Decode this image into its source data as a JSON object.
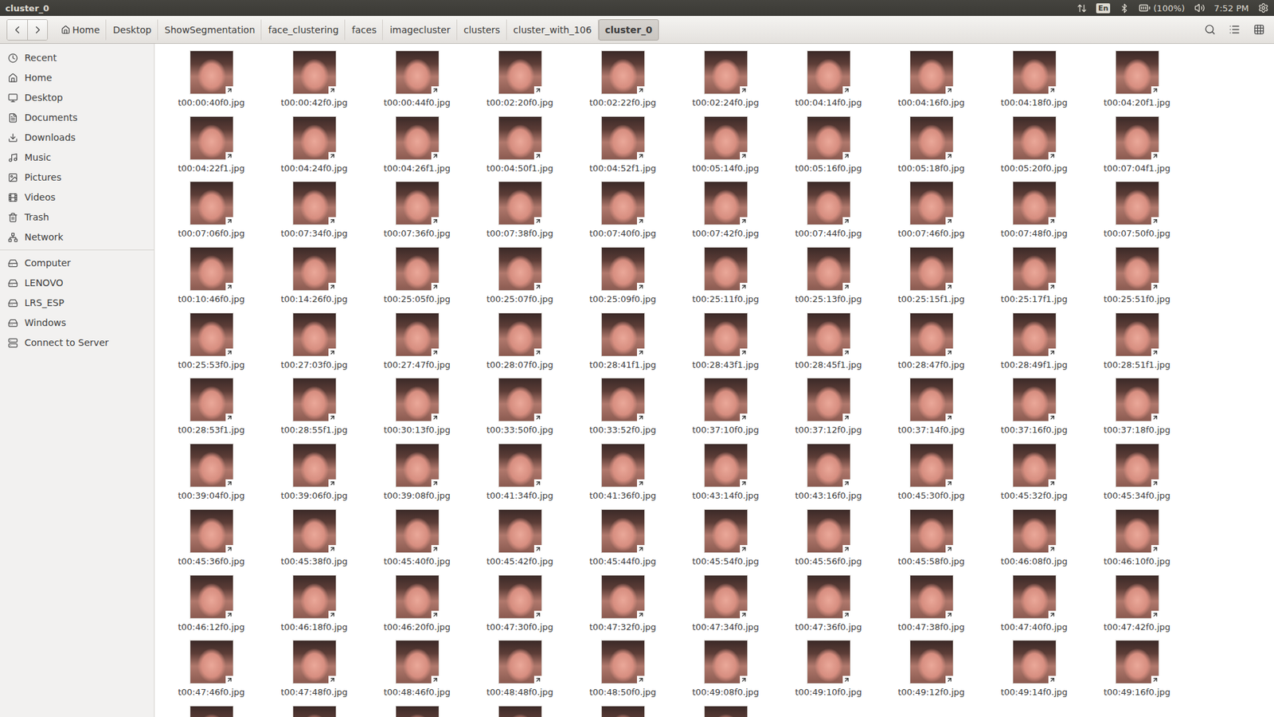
{
  "window": {
    "title": "cluster_0"
  },
  "panel": {
    "language": "En",
    "battery": "(100%)",
    "clock": "7:52 PM"
  },
  "pathbar": [
    {
      "label": "Home",
      "selected": false
    },
    {
      "label": "Desktop",
      "selected": false
    },
    {
      "label": "ShowSegmentation",
      "selected": false
    },
    {
      "label": "face_clustering",
      "selected": false
    },
    {
      "label": "faces",
      "selected": false
    },
    {
      "label": "imagecluster",
      "selected": false
    },
    {
      "label": "clusters",
      "selected": false
    },
    {
      "label": "cluster_with_106",
      "selected": false
    },
    {
      "label": "cluster_0",
      "selected": true
    }
  ],
  "sidebar": {
    "places": [
      {
        "label": "Recent"
      },
      {
        "label": "Home"
      },
      {
        "label": "Desktop"
      },
      {
        "label": "Documents"
      },
      {
        "label": "Downloads"
      },
      {
        "label": "Music"
      },
      {
        "label": "Pictures"
      },
      {
        "label": "Videos"
      },
      {
        "label": "Trash"
      },
      {
        "label": "Network"
      }
    ],
    "devices": [
      {
        "label": "Computer"
      },
      {
        "label": "LENOVO"
      },
      {
        "label": "LRS_ESP"
      },
      {
        "label": "Windows"
      },
      {
        "label": "Connect to Server"
      }
    ]
  },
  "files": [
    {
      "name": "t00:00:40f0.jpg"
    },
    {
      "name": "t00:00:42f0.jpg"
    },
    {
      "name": "t00:00:44f0.jpg"
    },
    {
      "name": "t00:02:20f0.jpg"
    },
    {
      "name": "t00:02:22f0.jpg"
    },
    {
      "name": "t00:02:24f0.jpg"
    },
    {
      "name": "t00:04:14f0.jpg"
    },
    {
      "name": "t00:04:16f0.jpg"
    },
    {
      "name": "t00:04:18f0.jpg"
    },
    {
      "name": "t00:04:20f1.jpg"
    },
    {
      "name": "t00:04:22f1.jpg"
    },
    {
      "name": "t00:04:24f0.jpg"
    },
    {
      "name": "t00:04:26f1.jpg"
    },
    {
      "name": "t00:04:50f1.jpg"
    },
    {
      "name": "t00:04:52f1.jpg"
    },
    {
      "name": "t00:05:14f0.jpg"
    },
    {
      "name": "t00:05:16f0.jpg"
    },
    {
      "name": "t00:05:18f0.jpg"
    },
    {
      "name": "t00:05:20f0.jpg"
    },
    {
      "name": "t00:07:04f1.jpg"
    },
    {
      "name": "t00:07:06f0.jpg"
    },
    {
      "name": "t00:07:34f0.jpg"
    },
    {
      "name": "t00:07:36f0.jpg"
    },
    {
      "name": "t00:07:38f0.jpg"
    },
    {
      "name": "t00:07:40f0.jpg"
    },
    {
      "name": "t00:07:42f0.jpg"
    },
    {
      "name": "t00:07:44f0.jpg"
    },
    {
      "name": "t00:07:46f0.jpg"
    },
    {
      "name": "t00:07:48f0.jpg"
    },
    {
      "name": "t00:07:50f0.jpg"
    },
    {
      "name": "t00:10:46f0.jpg"
    },
    {
      "name": "t00:14:26f0.jpg"
    },
    {
      "name": "t00:25:05f0.jpg"
    },
    {
      "name": "t00:25:07f0.jpg"
    },
    {
      "name": "t00:25:09f0.jpg"
    },
    {
      "name": "t00:25:11f0.jpg"
    },
    {
      "name": "t00:25:13f0.jpg"
    },
    {
      "name": "t00:25:15f1.jpg"
    },
    {
      "name": "t00:25:17f1.jpg"
    },
    {
      "name": "t00:25:51f0.jpg"
    },
    {
      "name": "t00:25:53f0.jpg"
    },
    {
      "name": "t00:27:03f0.jpg"
    },
    {
      "name": "t00:27:47f0.jpg"
    },
    {
      "name": "t00:28:07f0.jpg"
    },
    {
      "name": "t00:28:41f1.jpg"
    },
    {
      "name": "t00:28:43f1.jpg"
    },
    {
      "name": "t00:28:45f1.jpg"
    },
    {
      "name": "t00:28:47f0.jpg"
    },
    {
      "name": "t00:28:49f1.jpg"
    },
    {
      "name": "t00:28:51f1.jpg"
    },
    {
      "name": "t00:28:53f1.jpg"
    },
    {
      "name": "t00:28:55f1.jpg"
    },
    {
      "name": "t00:30:13f0.jpg"
    },
    {
      "name": "t00:33:50f0.jpg"
    },
    {
      "name": "t00:33:52f0.jpg"
    },
    {
      "name": "t00:37:10f0.jpg"
    },
    {
      "name": "t00:37:12f0.jpg"
    },
    {
      "name": "t00:37:14f0.jpg"
    },
    {
      "name": "t00:37:16f0.jpg"
    },
    {
      "name": "t00:37:18f0.jpg"
    },
    {
      "name": "t00:39:04f0.jpg"
    },
    {
      "name": "t00:39:06f0.jpg"
    },
    {
      "name": "t00:39:08f0.jpg"
    },
    {
      "name": "t00:41:34f0.jpg"
    },
    {
      "name": "t00:41:36f0.jpg"
    },
    {
      "name": "t00:43:14f0.jpg"
    },
    {
      "name": "t00:43:16f0.jpg"
    },
    {
      "name": "t00:45:30f0.jpg"
    },
    {
      "name": "t00:45:32f0.jpg"
    },
    {
      "name": "t00:45:34f0.jpg"
    },
    {
      "name": "t00:45:36f0.jpg"
    },
    {
      "name": "t00:45:38f0.jpg"
    },
    {
      "name": "t00:45:40f0.jpg"
    },
    {
      "name": "t00:45:42f0.jpg"
    },
    {
      "name": "t00:45:44f0.jpg"
    },
    {
      "name": "t00:45:54f0.jpg"
    },
    {
      "name": "t00:45:56f0.jpg"
    },
    {
      "name": "t00:45:58f0.jpg"
    },
    {
      "name": "t00:46:08f0.jpg"
    },
    {
      "name": "t00:46:10f0.jpg"
    },
    {
      "name": "t00:46:12f0.jpg"
    },
    {
      "name": "t00:46:18f0.jpg"
    },
    {
      "name": "t00:46:20f0.jpg"
    },
    {
      "name": "t00:47:30f0.jpg"
    },
    {
      "name": "t00:47:32f0.jpg"
    },
    {
      "name": "t00:47:34f0.jpg"
    },
    {
      "name": "t00:47:36f0.jpg"
    },
    {
      "name": "t00:47:38f0.jpg"
    },
    {
      "name": "t00:47:40f0.jpg"
    },
    {
      "name": "t00:47:42f0.jpg"
    },
    {
      "name": "t00:47:46f0.jpg"
    },
    {
      "name": "t00:47:48f0.jpg"
    },
    {
      "name": "t00:48:46f0.jpg"
    },
    {
      "name": "t00:48:48f0.jpg"
    },
    {
      "name": "t00:48:50f0.jpg"
    },
    {
      "name": "t00:49:08f0.jpg"
    },
    {
      "name": "t00:49:10f0.jpg"
    },
    {
      "name": "t00:49:12f0.jpg"
    },
    {
      "name": "t00:49:14f0.jpg"
    },
    {
      "name": "t00:49:16f0.jpg"
    }
  ],
  "partial_row": [
    {
      "kind": "thumbnail"
    },
    {
      "kind": "thumbnail"
    },
    {
      "kind": "thumbnail"
    },
    {
      "kind": "thumbnail"
    },
    {
      "kind": "thumbnail"
    },
    {
      "kind": "thumbnail"
    }
  ]
}
